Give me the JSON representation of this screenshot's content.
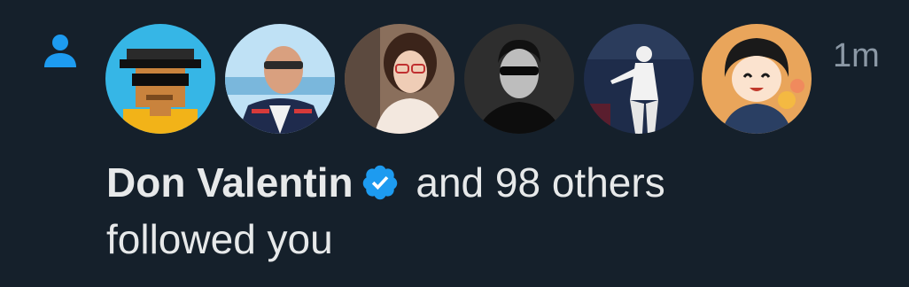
{
  "notification": {
    "type_icon": "person-icon",
    "timestamp": "1m",
    "avatars": [
      {
        "icon": "pixel-art-avatar"
      },
      {
        "icon": "man-sunglasses-avatar"
      },
      {
        "icon": "woman-glasses-avatar"
      },
      {
        "icon": "man-black-sunglasses-avatar"
      },
      {
        "icon": "woman-white-outfit-avatar"
      },
      {
        "icon": "anime-character-avatar"
      }
    ],
    "actor_name": "Don Valentin",
    "verified_icon": "verified-badge-icon",
    "others_text": "and 98 others",
    "action_text": "followed you"
  },
  "colors": {
    "background": "#15202b",
    "text_primary": "#e7e9ea",
    "text_secondary": "#8b98a5",
    "accent": "#1d9bf0"
  }
}
